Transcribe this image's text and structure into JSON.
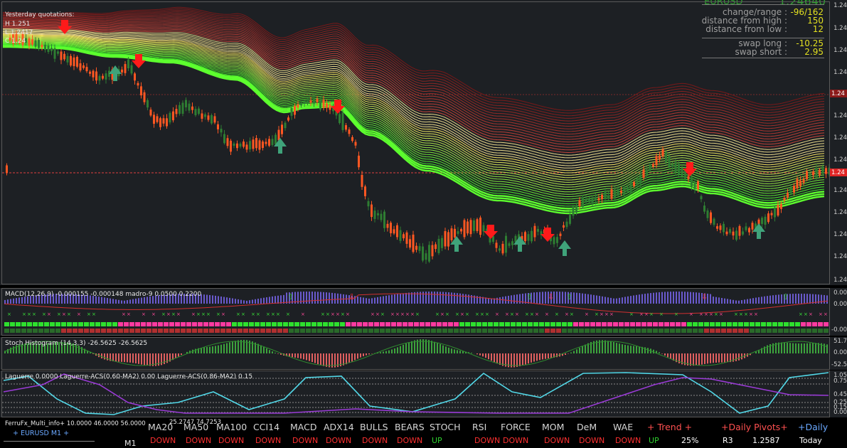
{
  "colors": {
    "bg": "#1d2024",
    "bull_candle": "#2e7d32",
    "bear_candle": "#ff5722",
    "sell_arrow": "#ff1a1a",
    "buy_arrow": "#3fa37a",
    "ribbon_green": "#5dff2e",
    "ribbon_red": "#7a1c1c",
    "price_line": "#e04040",
    "macd_hist": "#6a5acd",
    "stoch_pos": "#3da33d",
    "stoch_neg": "#e06060",
    "laguerre_1": "#52d8e8",
    "laguerre_2": "#9a3bd6",
    "accent_yellow": "#e2e020"
  },
  "quotations": {
    "title": "Yesterday quotations:",
    "high": "H 1.251",
    "low": "L 1.2417",
    "close": "C 1.24"
  },
  "symbol_box": {
    "symbol": "EURUSD",
    "price": "1.24640"
  },
  "stats": [
    {
      "label": "change/range :",
      "value": "-96/162"
    },
    {
      "label": "distance from high :",
      "value": "150"
    },
    {
      "label": "distance from low :",
      "value": "12"
    },
    {
      "label": "swap long :",
      "value": "-10.25"
    },
    {
      "label": "swap short :",
      "value": "2.95"
    }
  ],
  "main_axis_labels": [
    "1.24",
    "1.24",
    "1.24",
    "1.24",
    "1.24",
    "1.24",
    "1.24",
    "1.24",
    "1.24",
    "1.24",
    "1.24",
    "1.24"
  ],
  "price_marker": "1.24",
  "price_marker_2": "1.24",
  "macd": {
    "label": "MACD(12,26,9) -0.000155 -0.000148  madro-9 0.0500 0.2200",
    "axis": [
      "0.00",
      "0.00",
      "-0.00"
    ]
  },
  "stoch": {
    "label": "Stoch Histogram (14,3,3) -26.5625 -26.5625",
    "axis": [
      "51.7",
      "0.00",
      "-52.5"
    ]
  },
  "laguerre": {
    "label": "Laguerre 0.0000  Laguerre-ACS(0.60-MA2) 0.00  Laguerre-ACS(0.86-MA2) 0.15",
    "axis": [
      "1.05",
      "0.75",
      "0.45",
      "0.25",
      "0.15",
      "0.00"
    ]
  },
  "multi_info": {
    "title": "FerruFx_Multi_info+ 10.0000 46.0000 56.0000",
    "symbol_line": "+ EURUSD M1 +",
    "extra_values": "25.2747 74.7253",
    "timeframe": "M1",
    "headers": [
      "MA20",
      "MA50",
      "MA100",
      "CCI14",
      "MACD",
      "ADX14",
      "BULLS",
      "BEARS",
      "STOCH",
      "RSI",
      "FORCE",
      "MOM",
      "DeM",
      "WAE"
    ],
    "signals": [
      "DOWN",
      "DOWN",
      "DOWN",
      "DOWN",
      "DOWN",
      "DOWN",
      "DOWN",
      "DOWN",
      "UP",
      "DOWN",
      "DOWN",
      "DOWN",
      "DOWN",
      "DOWN"
    ],
    "trend_header": "+  Trend  +",
    "trend_dir": "UP",
    "trend_pct": "25%",
    "pivots_header": "+Daily Pivots+",
    "pivot_name": "R3",
    "pivot_value": "1.2587",
    "daily_header": "+Daily",
    "daily_value": "Today"
  }
}
